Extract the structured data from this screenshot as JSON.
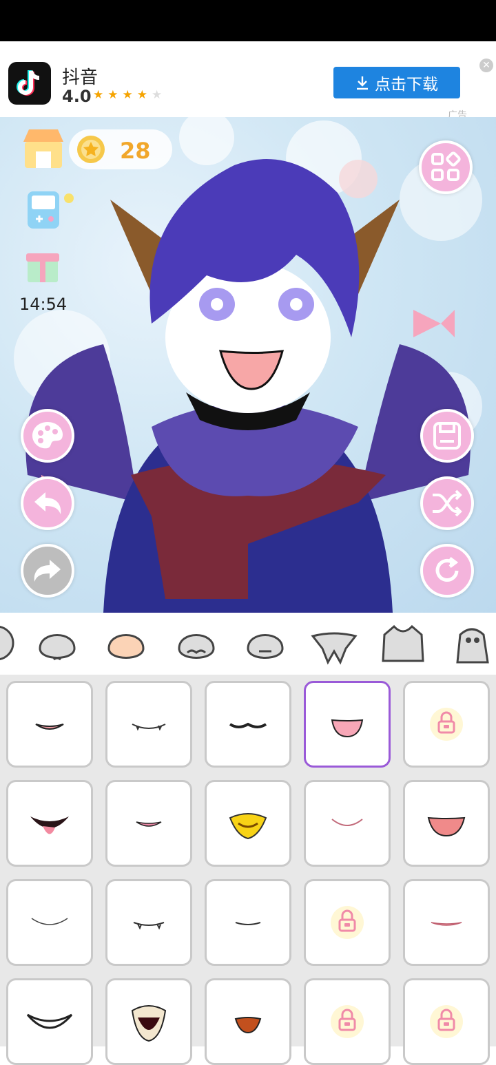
{
  "ad": {
    "app_name": "抖音",
    "rating": "4.0",
    "stars_filled": 4,
    "stars_total": 5,
    "download_label": "点击下载",
    "tag": "广告"
  },
  "hud": {
    "coins": "28",
    "time": "14:54"
  },
  "categories": [
    "head-partial",
    "head",
    "skin",
    "mustache",
    "face",
    "wings",
    "shirt",
    "creature"
  ],
  "selected_item": 3,
  "items": [
    {
      "kind": "smile-teeth",
      "locked": false
    },
    {
      "kind": "fang-smile",
      "locked": false
    },
    {
      "kind": "mustache-smile",
      "locked": false
    },
    {
      "kind": "open-fang",
      "locked": false
    },
    {
      "kind": "locked-mouth",
      "locked": true
    },
    {
      "kind": "monster-tongue",
      "locked": false
    },
    {
      "kind": "pink-smile",
      "locked": false
    },
    {
      "kind": "beak",
      "locked": false
    },
    {
      "kind": "soft-smile",
      "locked": false
    },
    {
      "kind": "open-grin",
      "locked": false
    },
    {
      "kind": "thin-smile",
      "locked": false
    },
    {
      "kind": "fang-line",
      "locked": false
    },
    {
      "kind": "small-smile",
      "locked": false
    },
    {
      "kind": "locked-mouth",
      "locked": true
    },
    {
      "kind": "pink-line",
      "locked": false
    },
    {
      "kind": "wide-grin",
      "locked": false
    },
    {
      "kind": "big-beak",
      "locked": false
    },
    {
      "kind": "open-mouth",
      "locked": false
    },
    {
      "kind": "locked-mouth",
      "locked": true
    },
    {
      "kind": "locked-mouth",
      "locked": true
    }
  ]
}
